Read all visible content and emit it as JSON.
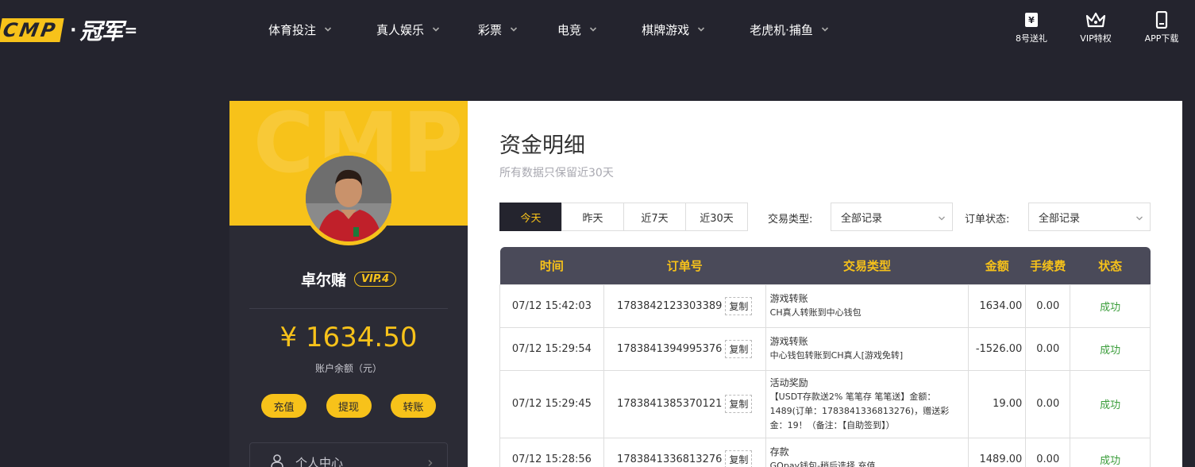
{
  "header": {
    "logo_text": "CMP",
    "logo_sep": "·",
    "logo_cn": "冠军",
    "nav": [
      {
        "label": "体育投注"
      },
      {
        "label": "真人娱乐"
      },
      {
        "label": "彩票"
      },
      {
        "label": "电竞"
      },
      {
        "label": "棋牌游戏"
      },
      {
        "label": "老虎机·捕鱼"
      }
    ],
    "right_items": [
      {
        "label": "8号送礼",
        "icon": "gift-icon"
      },
      {
        "label": "VIP特权",
        "icon": "crown-icon"
      },
      {
        "label": "APP下载",
        "icon": "phone-icon"
      }
    ]
  },
  "sidebar": {
    "banner_text": "CMP",
    "username": "卓尔赌",
    "vip": "VIP.4",
    "balance": "¥ 1634.50",
    "balance_label": "账户余额（元）",
    "buttons": [
      "充值",
      "提现",
      "转账"
    ],
    "menu_item": "个人中心"
  },
  "main": {
    "title": "资金明细",
    "subtitle": "所有数据只保留近30天",
    "tabs": [
      "今天",
      "昨天",
      "近7天",
      "近30天"
    ],
    "active_tab": "今天",
    "type_filter_label": "交易类型:",
    "type_filter_value": "全部记录",
    "status_filter_label": "订单状态:",
    "status_filter_value": "全部记录",
    "columns": [
      "时间",
      "订单号",
      "交易类型",
      "金额",
      "手续费",
      "状态"
    ],
    "copy_label": "复制",
    "rows": [
      {
        "time": "07/12 15:42:03",
        "order": "1783842123303389",
        "type_title": "游戏转账",
        "type_desc": "CH真人转账到中心钱包",
        "amount": "1634.00",
        "fee": "0.00",
        "status": "成功"
      },
      {
        "time": "07/12 15:29:54",
        "order": "1783841394995376",
        "type_title": "游戏转账",
        "type_desc": "中心钱包转账到CH真人[游戏免转]",
        "amount": "-1526.00",
        "fee": "0.00",
        "status": "成功"
      },
      {
        "time": "07/12 15:29:45",
        "order": "1783841385370121",
        "type_title": "活动奖励",
        "type_desc": "【USDT存款送2% 笔笔存 笔笔送】金额：1489(订单：1783841336813276)，赠送彩金：19！（备注：【自助签到】）",
        "amount": "19.00",
        "fee": "0.00",
        "status": "成功"
      },
      {
        "time": "07/12 15:28:56",
        "order": "1783841336813276",
        "type_title": "存款",
        "type_desc": "GOpay钱包-稍后选择 充值",
        "amount": "1489.00",
        "fee": "0.00",
        "status": "成功"
      }
    ]
  },
  "colors": {
    "accent": "#f7c21a",
    "bg_dark": "#24242e",
    "panel_dark": "#2b2b35",
    "success": "#3a9d3a"
  }
}
